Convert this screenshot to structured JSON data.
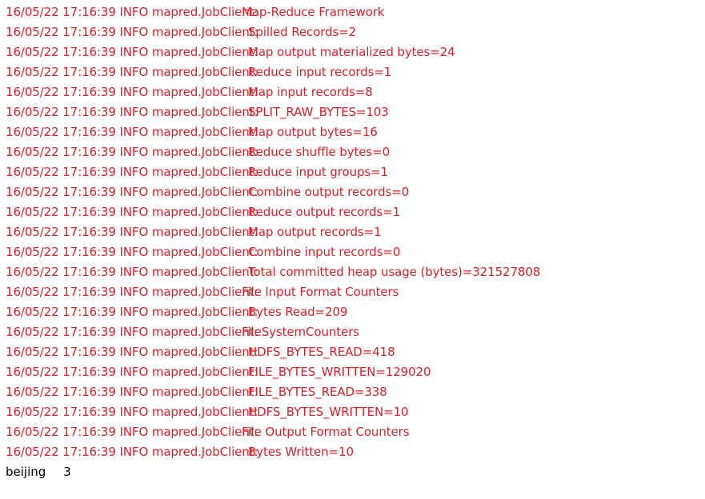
{
  "terminal": {
    "log_color": "#d8222a",
    "output_color": "#000000",
    "background_color": "#ffffff",
    "log_prefix": "16/05/22 17:16:39 INFO mapred.JobClient:",
    "timestamp": "16/05/22 17:16:39",
    "level": "INFO",
    "logger": "mapred.JobClient",
    "lines": [
      {
        "prefix": "16/05/22 17:16:39 INFO mapred.JobClient:",
        "message": "Map-Reduce Framework",
        "indent": 0
      },
      {
        "prefix": "16/05/22 17:16:39 INFO mapred.JobClient:",
        "message": "Spilled Records=2",
        "indent": 1
      },
      {
        "prefix": "16/05/22 17:16:39 INFO mapred.JobClient:",
        "message": "Map output materialized bytes=24",
        "indent": 1
      },
      {
        "prefix": "16/05/22 17:16:39 INFO mapred.JobClient:",
        "message": "Reduce input records=1",
        "indent": 1
      },
      {
        "prefix": "16/05/22 17:16:39 INFO mapred.JobClient:",
        "message": "Map input records=8",
        "indent": 1
      },
      {
        "prefix": "16/05/22 17:16:39 INFO mapred.JobClient:",
        "message": "SPLIT_RAW_BYTES=103",
        "indent": 1
      },
      {
        "prefix": "16/05/22 17:16:39 INFO mapred.JobClient:",
        "message": "Map output bytes=16",
        "indent": 1
      },
      {
        "prefix": "16/05/22 17:16:39 INFO mapred.JobClient:",
        "message": "Reduce shuffle bytes=0",
        "indent": 1
      },
      {
        "prefix": "16/05/22 17:16:39 INFO mapred.JobClient:",
        "message": "Reduce input groups=1",
        "indent": 1
      },
      {
        "prefix": "16/05/22 17:16:39 INFO mapred.JobClient:",
        "message": "Combine output records=0",
        "indent": 1
      },
      {
        "prefix": "16/05/22 17:16:39 INFO mapred.JobClient:",
        "message": "Reduce output records=1",
        "indent": 1
      },
      {
        "prefix": "16/05/22 17:16:39 INFO mapred.JobClient:",
        "message": "Map output records=1",
        "indent": 1
      },
      {
        "prefix": "16/05/22 17:16:39 INFO mapred.JobClient:",
        "message": "Combine input records=0",
        "indent": 1
      },
      {
        "prefix": "16/05/22 17:16:39 INFO mapred.JobClient:",
        "message": "Total committed heap usage (bytes)=321527808",
        "indent": 1
      },
      {
        "prefix": "16/05/22 17:16:39 INFO mapred.JobClient:",
        "message": "File Input Format Counters",
        "indent": 0
      },
      {
        "prefix": "16/05/22 17:16:39 INFO mapred.JobClient:",
        "message": "Bytes Read=209",
        "indent": 1
      },
      {
        "prefix": "16/05/22 17:16:39 INFO mapred.JobClient:",
        "message": "FileSystemCounters",
        "indent": 0
      },
      {
        "prefix": "16/05/22 17:16:39 INFO mapred.JobClient:",
        "message": "HDFS_BYTES_READ=418",
        "indent": 1
      },
      {
        "prefix": "16/05/22 17:16:39 INFO mapred.JobClient:",
        "message": "FILE_BYTES_WRITTEN=129020",
        "indent": 1
      },
      {
        "prefix": "16/05/22 17:16:39 INFO mapred.JobClient:",
        "message": "FILE_BYTES_READ=338",
        "indent": 1
      },
      {
        "prefix": "16/05/22 17:16:39 INFO mapred.JobClient:",
        "message": "HDFS_BYTES_WRITTEN=10",
        "indent": 1
      },
      {
        "prefix": "16/05/22 17:16:39 INFO mapred.JobClient:",
        "message": "File Output Format Counters",
        "indent": 0
      },
      {
        "prefix": "16/05/22 17:16:39 INFO mapred.JobClient:",
        "message": "Bytes Written=10",
        "indent": 1
      }
    ],
    "program_output": [
      {
        "key": "beijing",
        "value": "3"
      }
    ]
  }
}
